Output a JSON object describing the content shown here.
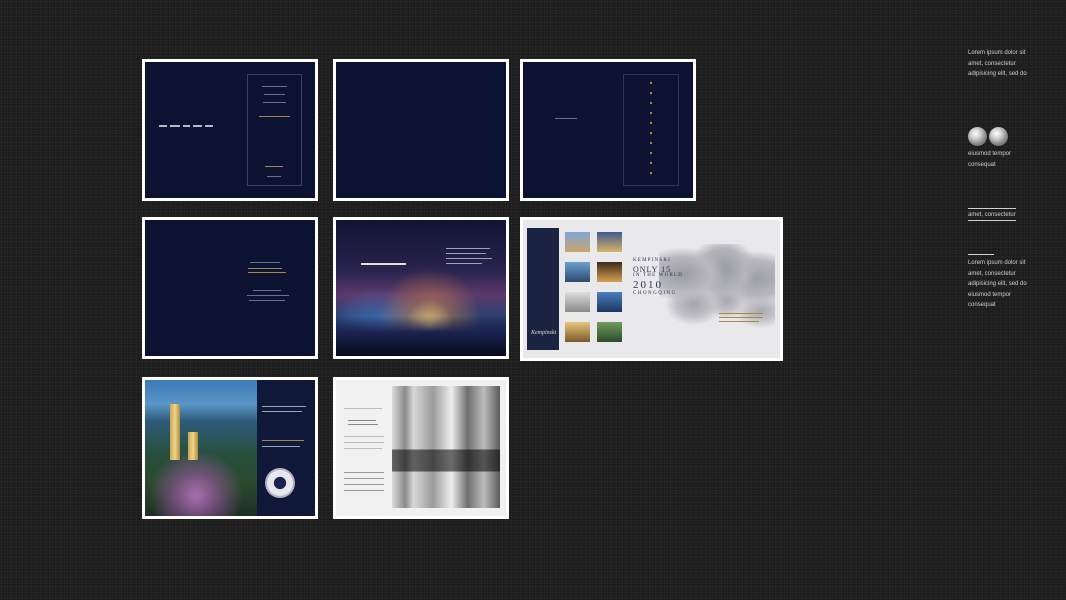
{
  "sidebar": {
    "block1": [
      "Lorem ipsum dolor sit",
      "amet, consectetur",
      "adipisicing elit, sed do"
    ],
    "globes": [
      "globe-icon",
      "globe-icon"
    ],
    "block2": [
      "eiusmod tempor",
      "consequat"
    ],
    "block3": [
      "amet, consectetur"
    ],
    "block4": [
      "Lorem ipsum dolor sit",
      "amet, consectetur",
      "adipisicing elit, sed do",
      "eiusmod tempor",
      "consequat"
    ]
  },
  "pages": {
    "kempinski": {
      "line1": "KEMPINSKI",
      "line2": "ONLY 15",
      "line3": "IN THE WORLD",
      "line4": "2010",
      "line5": "CHONGQING",
      "signature": "Kempinski"
    }
  },
  "colors": {
    "background": "#1e1e1e",
    "navy": "#0b1232",
    "gold": "#a6884a",
    "frame": "#ffffff"
  }
}
